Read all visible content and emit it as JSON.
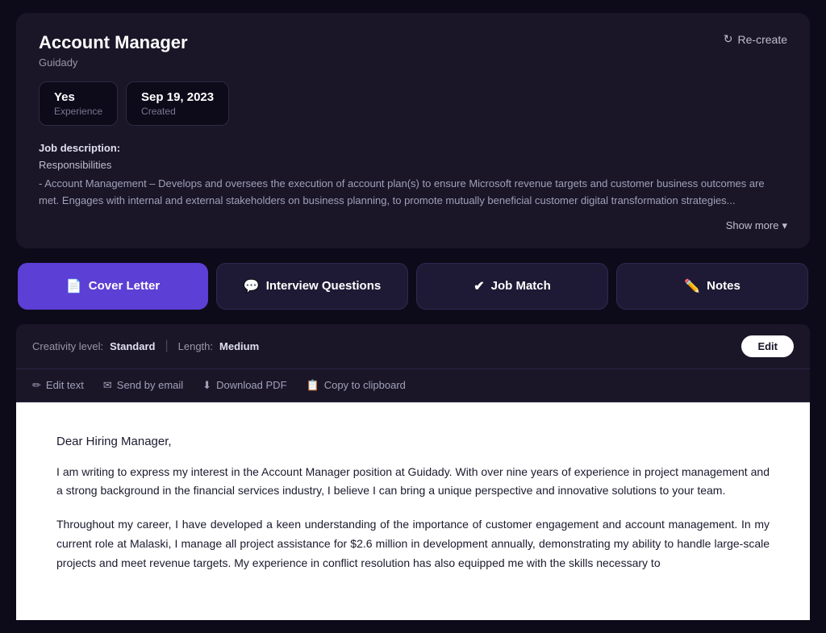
{
  "jobCard": {
    "title": "Account Manager",
    "company": "Guidady",
    "recreateLabel": "Re-create",
    "experience": {
      "value": "Yes",
      "label": "Experience"
    },
    "created": {
      "value": "Sep 19, 2023",
      "label": "Created"
    },
    "descriptionLabel": "Job description:",
    "descriptionSectionLabel": "Responsibilities",
    "descriptionText": "- Account Management – Develops and oversees the execution of account plan(s) to ensure Microsoft revenue targets and customer business outcomes are met. Engages with internal and external stakeholders on business planning, to promote mutually beneficial customer digital transformation strategies...",
    "showMoreLabel": "Show more"
  },
  "actionButtons": [
    {
      "id": "cover-letter",
      "label": "Cover Letter",
      "icon": "📄",
      "active": true
    },
    {
      "id": "interview-questions",
      "label": "Interview Questions",
      "icon": "💬",
      "active": false
    },
    {
      "id": "job-match",
      "label": "Job Match",
      "icon": "✔",
      "active": false
    },
    {
      "id": "notes",
      "label": "Notes",
      "icon": "✏️",
      "active": false
    }
  ],
  "settingsBar": {
    "creativityLabel": "Creativity level:",
    "creativityValue": "Standard",
    "lengthLabel": "Length:",
    "lengthValue": "Medium",
    "editLabel": "Edit"
  },
  "toolbar": {
    "editText": "Edit text",
    "sendByEmail": "Send by email",
    "downloadPDF": "Download PDF",
    "copyToClipboard": "Copy to clipboard"
  },
  "letter": {
    "salutation": "Dear Hiring Manager,",
    "paragraph1": "I am writing to express my interest in the Account Manager position at Guidady. With over nine years of experience in project management and a strong background in the financial services industry, I believe I can bring a unique perspective and innovative solutions to your team.",
    "paragraph2": "Throughout my career, I have developed a keen understanding of the importance of customer engagement and account management. In my current role at Malaski, I manage all project assistance for $2.6 million in development annually, demonstrating my ability to handle large-scale projects and meet revenue targets. My experience in conflict resolution has also equipped me with the skills necessary to"
  }
}
